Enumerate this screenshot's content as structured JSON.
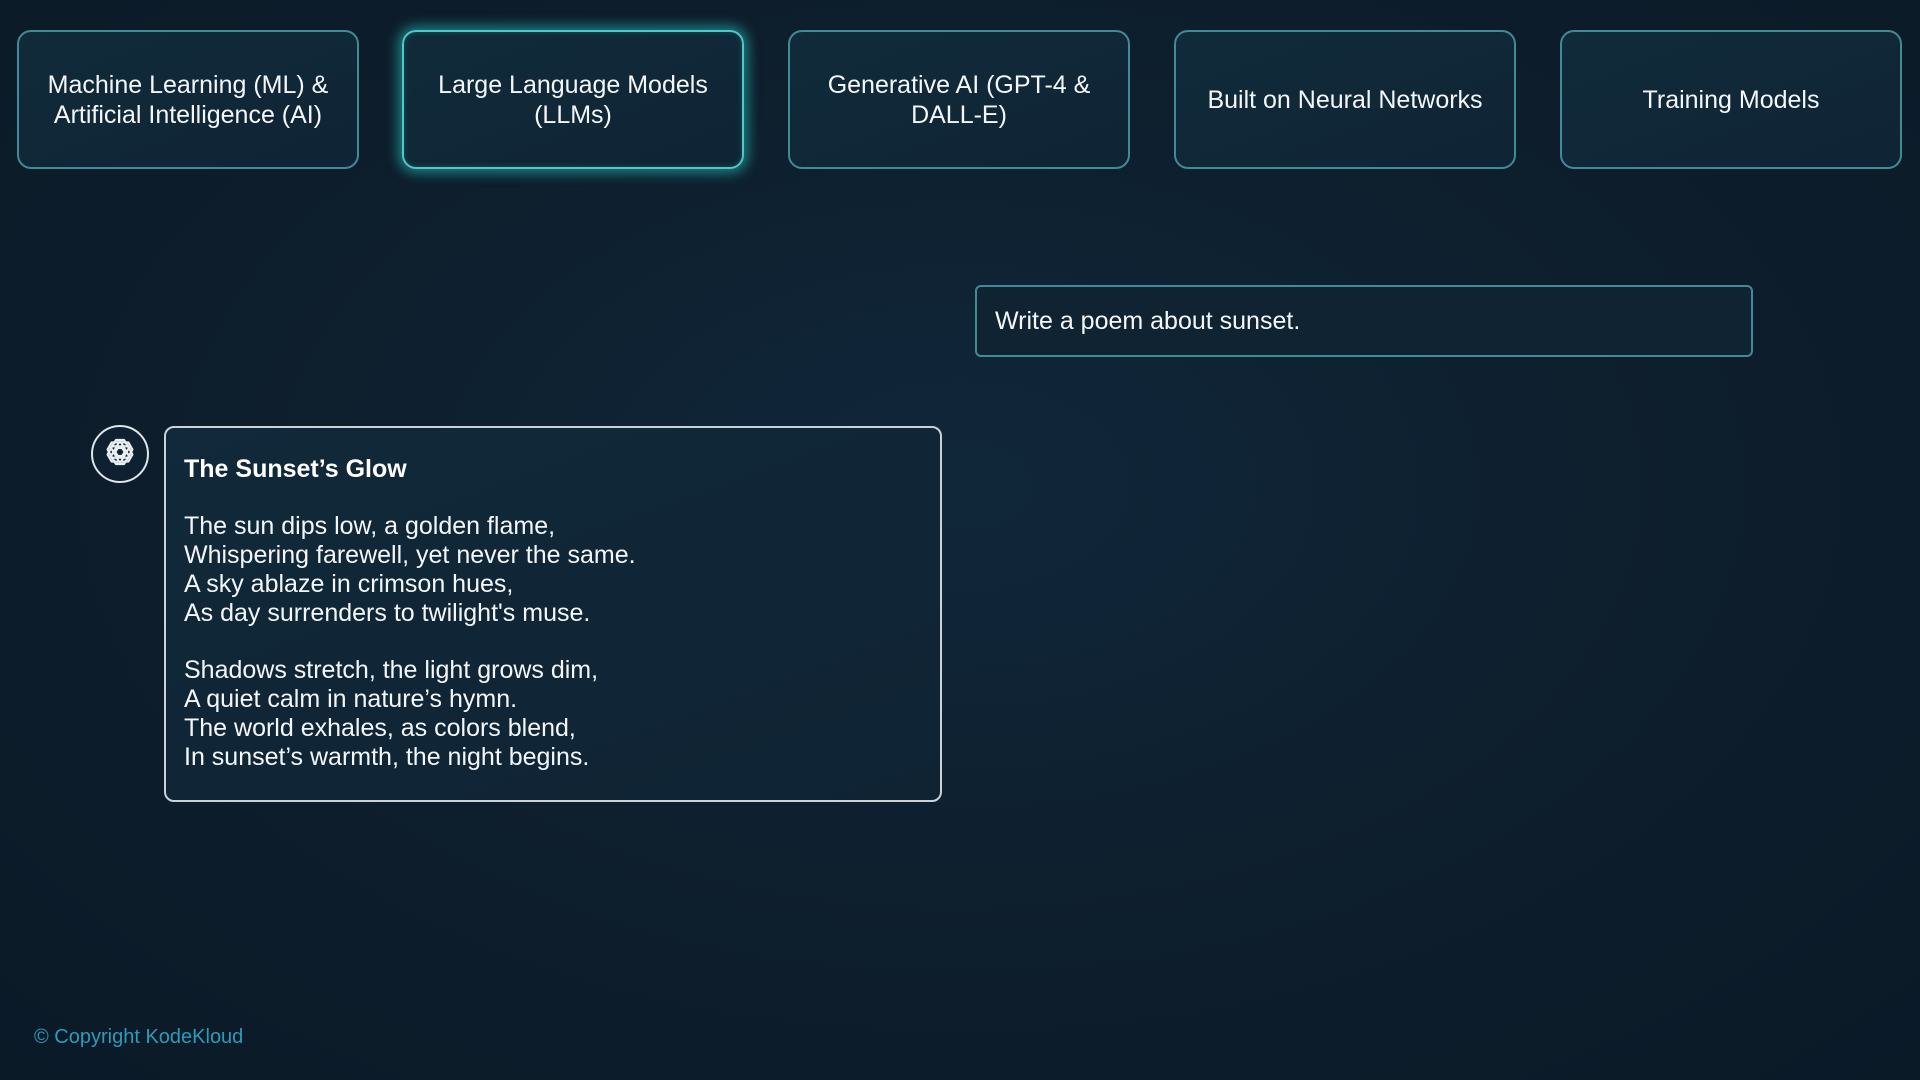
{
  "tabs": [
    {
      "label": "Machine Learning (ML) & Artificial Intelligence (AI)",
      "active": false
    },
    {
      "label": "Large Language Models (LLMs)",
      "active": true
    },
    {
      "label": "Generative AI (GPT-4 & DALL-E)",
      "active": false
    },
    {
      "label": "Built on Neural Networks",
      "active": false
    },
    {
      "label": "Training Models",
      "active": false
    }
  ],
  "prompt": {
    "text": "Write a poem about sunset."
  },
  "response": {
    "avatar_icon": "openai-logo-icon",
    "title": "The Sunset’s Glow",
    "stanzas": [
      {
        "lines": [
          "The sun dips low, a golden flame,",
          "Whispering farewell, yet never the same.",
          "A sky ablaze in crimson hues,",
          "As day surrenders to twilight's muse."
        ]
      },
      {
        "lines": [
          "Shadows stretch, the light grows dim,",
          "A quiet calm in nature’s hymn.",
          "The world exhales, as colors blend,",
          "In sunset’s warmth, the night begins."
        ]
      }
    ]
  },
  "footer": {
    "copyright": "© Copyright KodeKloud"
  },
  "colors": {
    "background": "#0e1e2c",
    "accent": "#4ec8c8",
    "border": "#3f8c95",
    "copyright": "#2e9ab8"
  }
}
